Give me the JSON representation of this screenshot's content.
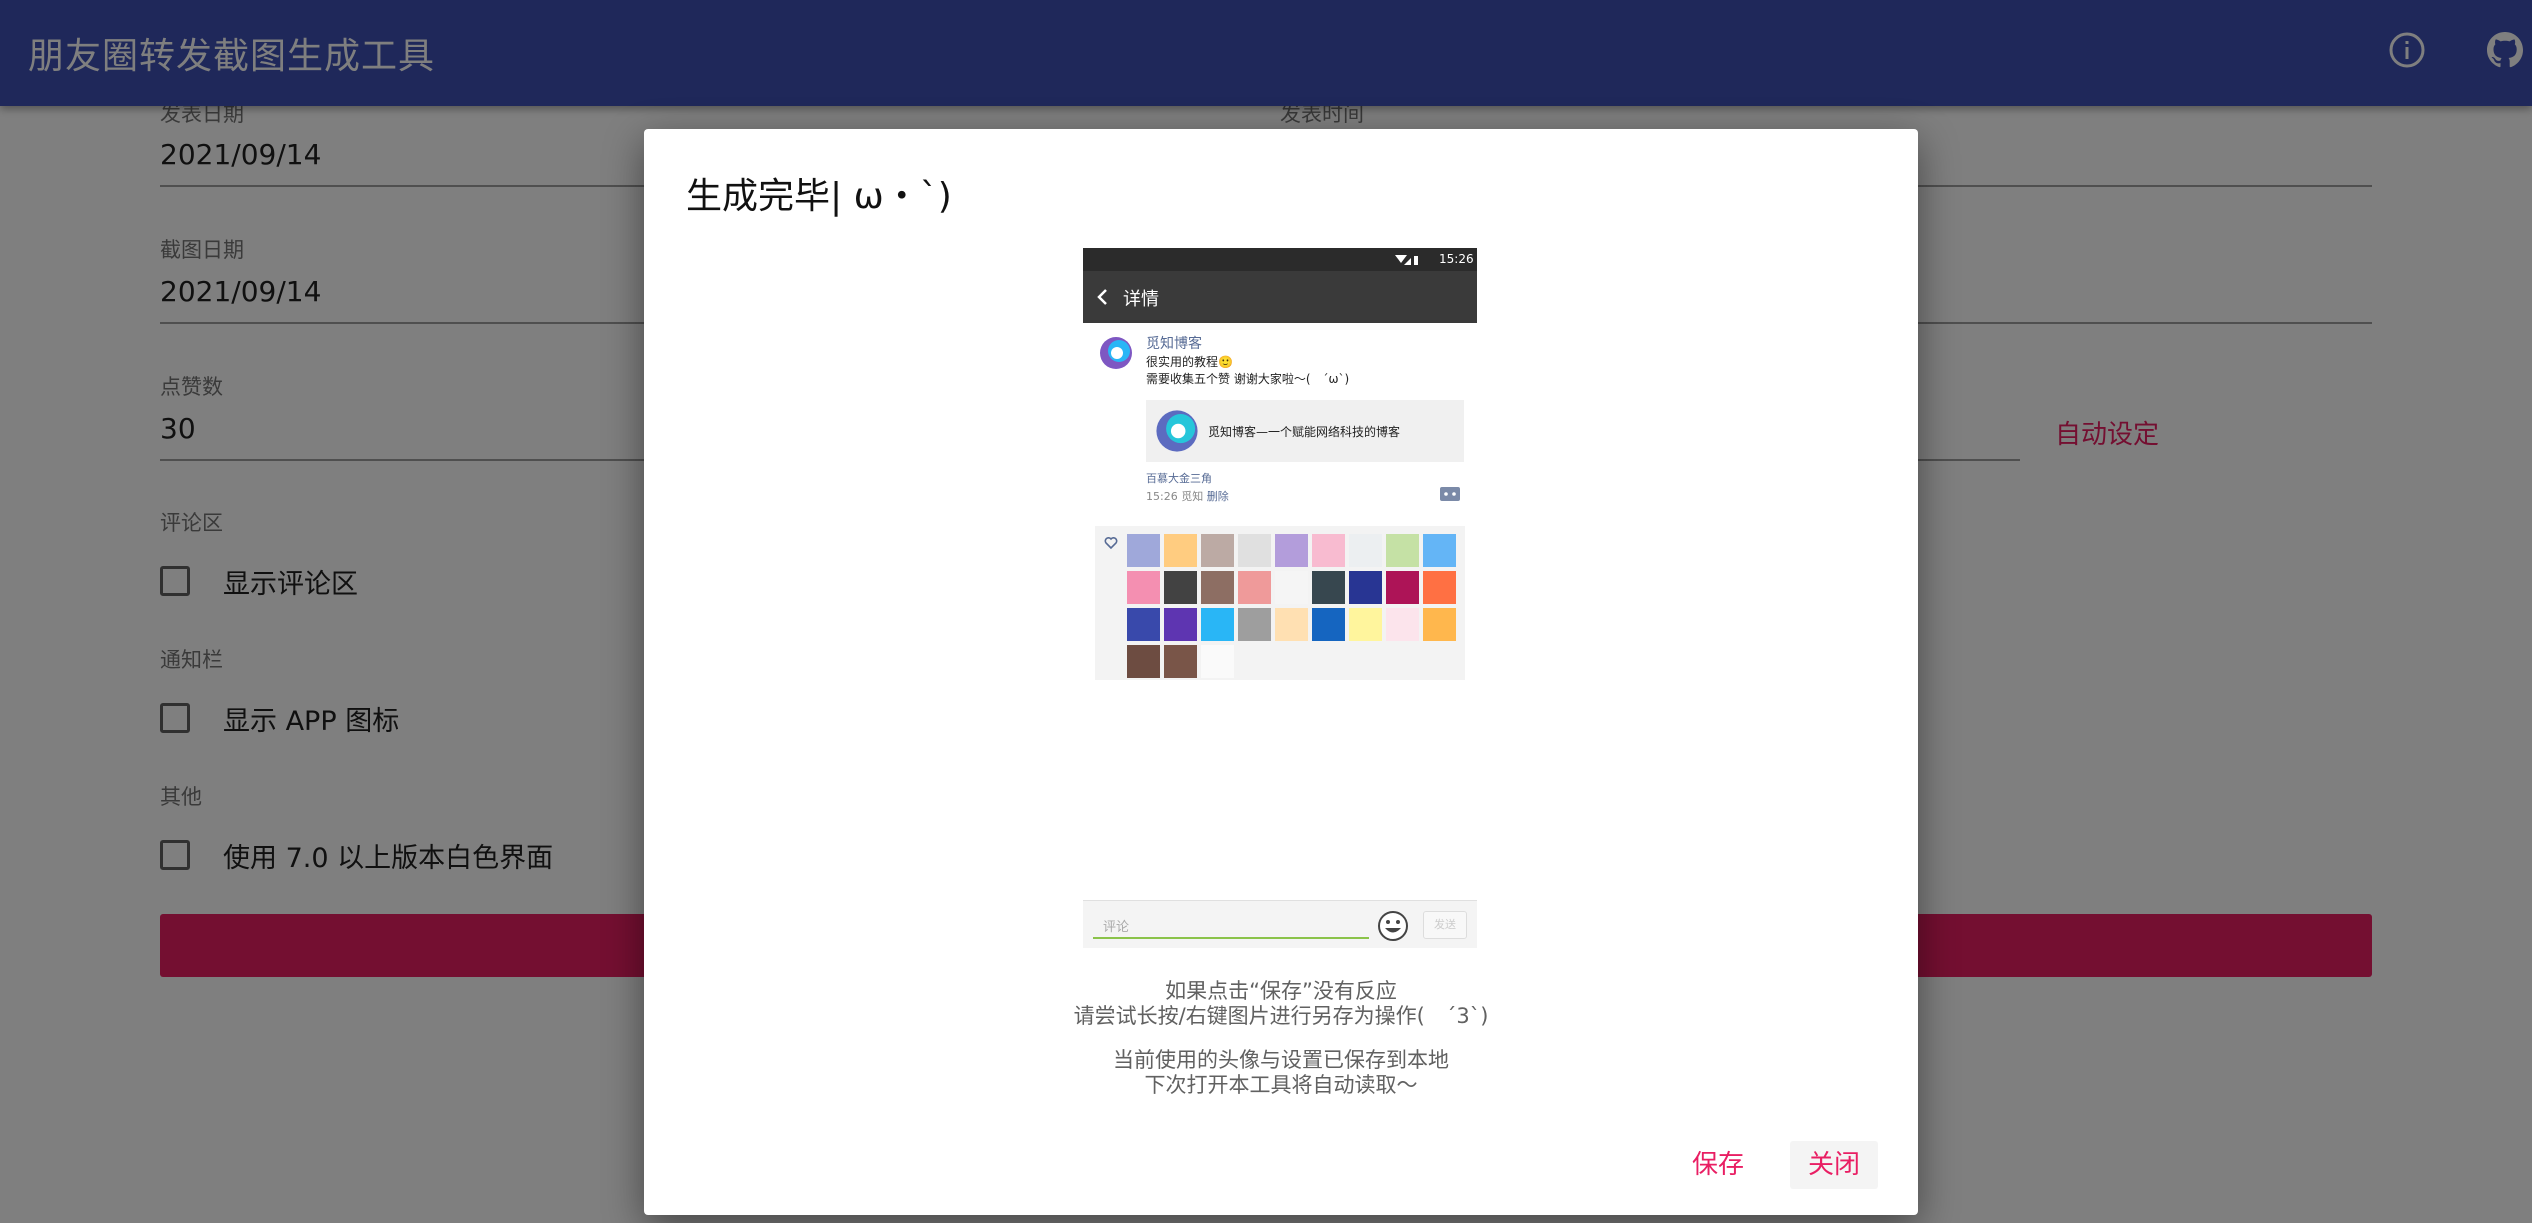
{
  "app": {
    "title": "朋友圈转发截图生成工具",
    "info_icon": "info-icon",
    "github_icon": "github-icon",
    "primary_color": "#3f51b5",
    "accent_color": "#e91e63"
  },
  "form": {
    "publish_date": {
      "label": "发表日期",
      "value": "2021/09/14"
    },
    "publish_time": {
      "label": "发表时间"
    },
    "screenshot_date": {
      "label": "截图日期",
      "value": "2021/09/14"
    },
    "likes": {
      "label": "点赞数",
      "value": "30",
      "auto_label": "自动设定"
    },
    "comment_section": {
      "label": "评论区",
      "checkbox_label": "显示评论区",
      "checked": false
    },
    "notification_bar": {
      "label": "通知栏",
      "checkbox_label": "显示 APP 图标",
      "checked": false
    },
    "other": {
      "label": "其他",
      "checkbox_label": "使用 7.0 以上版本白色界面",
      "checked": false
    }
  },
  "dialog": {
    "title": "生成完毕| ω・`)",
    "hint_line1": "如果点击“保存”没有反应",
    "hint_line2": "请尝试长按/右键图片进行另存为操作(　´3`)",
    "hint_line3": "当前使用的头像与设置已保存到本地",
    "hint_line4": "下次打开本工具将自动读取～",
    "save_label": "保存",
    "close_label": "关闭"
  },
  "preview": {
    "time": "15:26",
    "nav_title": "详情",
    "author": "觅知博客",
    "text_line1": "很实用的教程🙂",
    "text_line2": "需要收集五个赞 谢谢大家啦～(　´ω`)",
    "link_title": "觅知博客—一个赋能网络科技的博客",
    "location": "百慕大金三角",
    "post_time": "15:26 觅知",
    "delete_label": "删除",
    "comment_placeholder": "评论",
    "send_label": "发送"
  }
}
